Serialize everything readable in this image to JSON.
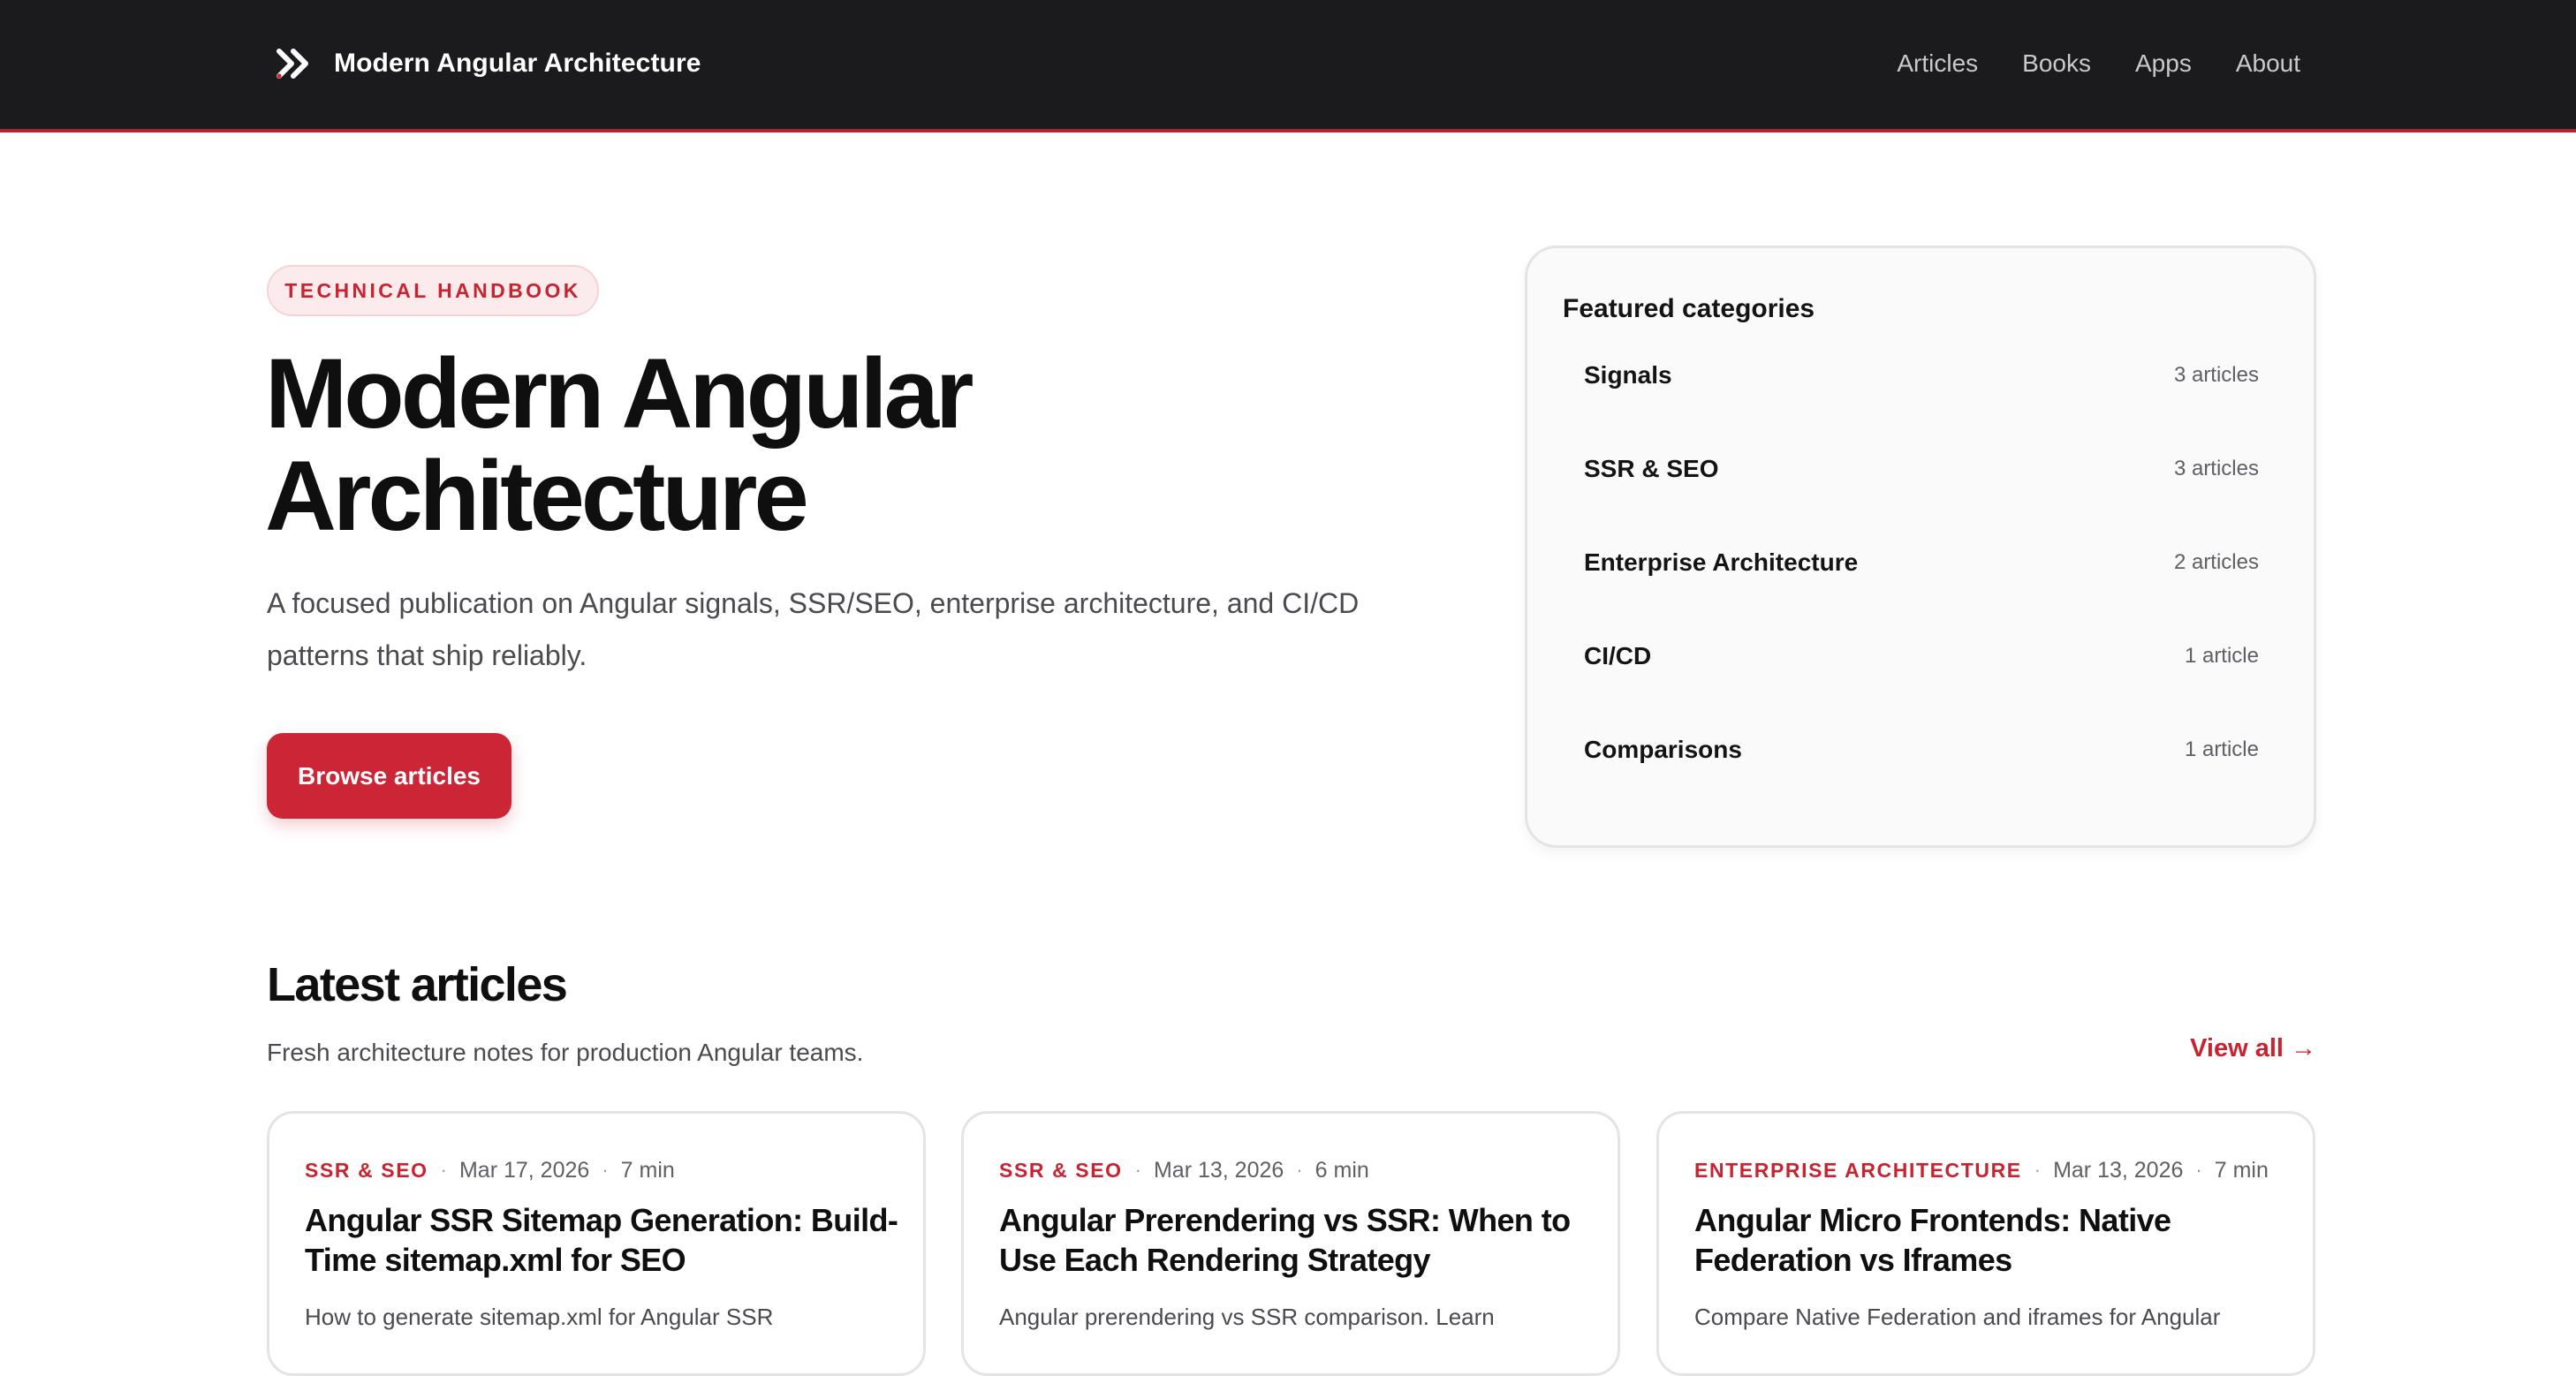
{
  "header": {
    "brand_title": "Modern Angular Architecture",
    "nav": [
      "Articles",
      "Books",
      "Apps",
      "About"
    ]
  },
  "hero": {
    "badge": "TECHNICAL HANDBOOK",
    "title_line1": "Modern Angular",
    "title_line2": "Architecture",
    "description": "A focused publication on Angular signals, SSR/SEO, enterprise architecture, and CI/CD patterns that ship reliably.",
    "cta_label": "Browse articles"
  },
  "featured": {
    "title": "Featured categories",
    "categories": [
      {
        "name": "Signals",
        "count": "3 articles"
      },
      {
        "name": "SSR & SEO",
        "count": "3 articles"
      },
      {
        "name": "Enterprise Architecture",
        "count": "2 articles"
      },
      {
        "name": "CI/CD",
        "count": "1 article"
      },
      {
        "name": "Comparisons",
        "count": "1 article"
      }
    ]
  },
  "latest": {
    "heading": "Latest articles",
    "subtitle": "Fresh architecture notes for production Angular teams.",
    "view_all": "View all →",
    "articles": [
      {
        "category": "SSR & SEO",
        "date": "Mar 17, 2026",
        "read_time": "7 min",
        "title": "Angular SSR Sitemap Generation: Build-Time sitemap.xml for SEO",
        "excerpt": "How to generate sitemap.xml for Angular SSR"
      },
      {
        "category": "SSR & SEO",
        "date": "Mar 13, 2026",
        "read_time": "6 min",
        "title": "Angular Prerendering vs SSR: When to Use Each Rendering Strategy",
        "excerpt": "Angular prerendering vs SSR comparison. Learn"
      },
      {
        "category": "ENTERPRISE ARCHITECTURE",
        "date": "Mar 13, 2026",
        "read_time": "7 min",
        "title": "Angular Micro Frontends: Native Federation vs Iframes",
        "excerpt": "Compare Native Federation and iframes for Angular"
      }
    ]
  },
  "colors": {
    "header_bg": "#1b1b1d",
    "accent": "#cc2535",
    "badge_bg": "#fcebed"
  },
  "icons": {
    "brand": "double-chevron-right-icon"
  }
}
